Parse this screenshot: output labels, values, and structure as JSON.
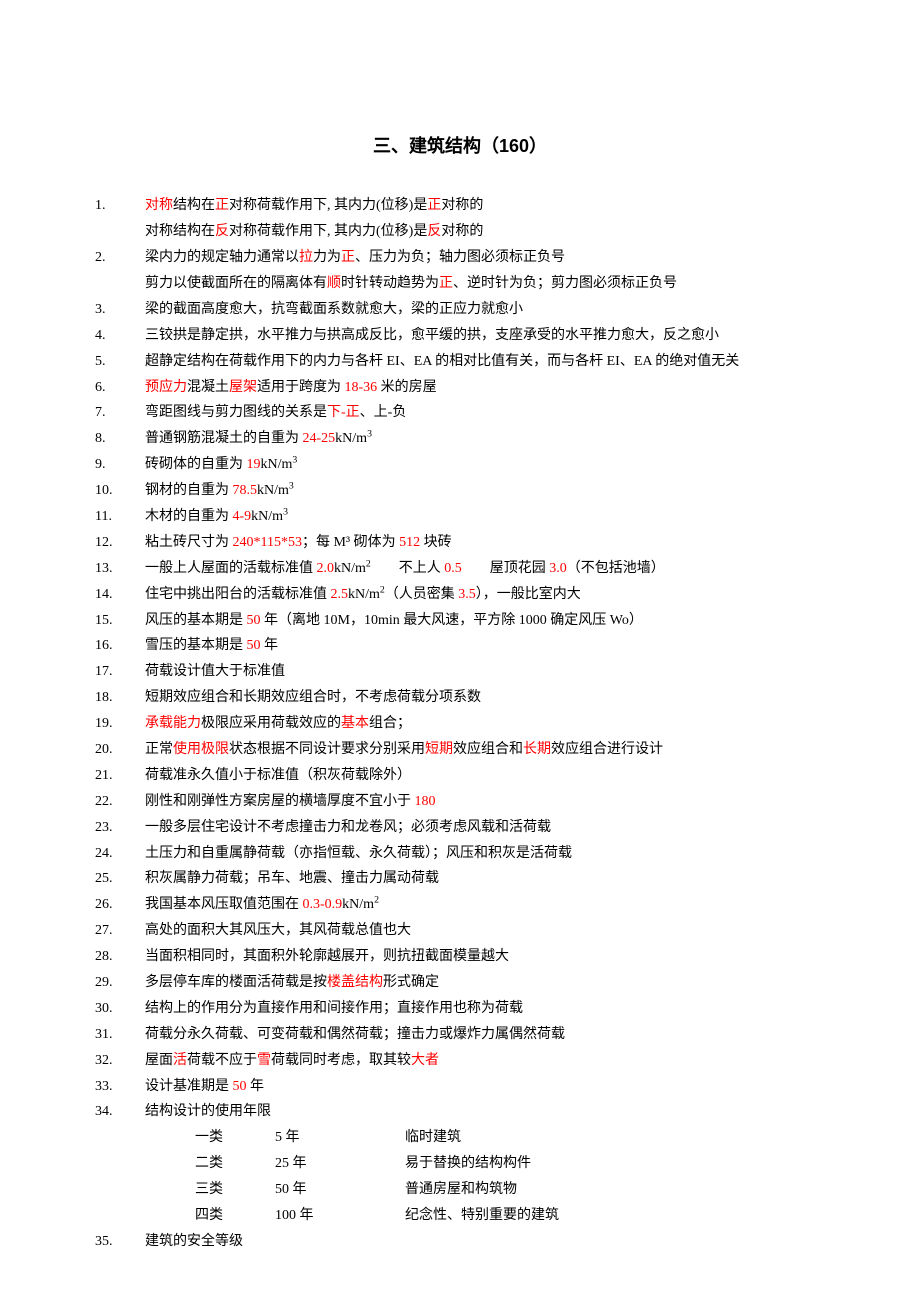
{
  "title": "三、建筑结构（160）",
  "items": [
    {
      "segs": [
        {
          "t": "对称",
          "c": "r"
        },
        {
          "t": "结构在"
        },
        {
          "t": "正",
          "c": "r"
        },
        {
          "t": "对称荷载作用下, 其内力(位移)是"
        },
        {
          "t": "正",
          "c": "r"
        },
        {
          "t": "对称的"
        }
      ],
      "sub": [
        {
          "t": "对称结构在"
        },
        {
          "t": "反",
          "c": "r"
        },
        {
          "t": "对称荷载作用下, 其内力(位移)是"
        },
        {
          "t": "反",
          "c": "r"
        },
        {
          "t": "对称的"
        }
      ]
    },
    {
      "segs": [
        {
          "t": "梁内力的规定轴力通常以"
        },
        {
          "t": "拉",
          "c": "r"
        },
        {
          "t": "力为"
        },
        {
          "t": "正",
          "c": "r"
        },
        {
          "t": "、压力为负；轴力图必须标正负号"
        }
      ],
      "sub": [
        {
          "t": "剪力以使截面所在的隔离体有"
        },
        {
          "t": "顺",
          "c": "r"
        },
        {
          "t": "时针转动趋势为"
        },
        {
          "t": "正",
          "c": "r"
        },
        {
          "t": "、逆时针为负；剪力图必须标正负号"
        }
      ]
    },
    {
      "segs": [
        {
          "t": "梁的截面高度愈大，抗弯截面系数就愈大，梁的正应力就愈小"
        }
      ]
    },
    {
      "segs": [
        {
          "t": "三铰拱是静定拱，水平推力与拱高成反比，愈平缓的拱，支座承受的水平推力愈大，反之愈小"
        }
      ]
    },
    {
      "segs": [
        {
          "t": "超静定结构在荷载作用下的内力与各杆 EI、EA 的相对比值有关，而与各杆 EI、EA 的绝对值无关"
        }
      ]
    },
    {
      "segs": [
        {
          "t": "预应力",
          "c": "r"
        },
        {
          "t": "混凝土"
        },
        {
          "t": "屋架",
          "c": "r"
        },
        {
          "t": "适用于跨度为 "
        },
        {
          "t": "18-36",
          "c": "r"
        },
        {
          "t": " 米的房屋"
        }
      ]
    },
    {
      "segs": [
        {
          "t": "弯距图线与剪力图线的关系是"
        },
        {
          "t": "下-正",
          "c": "r"
        },
        {
          "t": "、上-负"
        }
      ]
    },
    {
      "segs": [
        {
          "t": "普通钢筋混凝土的自重为 "
        },
        {
          "t": "24-25",
          "c": "r"
        },
        {
          "t": "kN/m",
          "sup": "3"
        }
      ]
    },
    {
      "segs": [
        {
          "t": "砖砌体的自重为 "
        },
        {
          "t": "19",
          "c": "r"
        },
        {
          "t": "kN/m",
          "sup": "3"
        }
      ]
    },
    {
      "segs": [
        {
          "t": "钢材的自重为 "
        },
        {
          "t": "78.5",
          "c": "r"
        },
        {
          "t": "kN/m",
          "sup": "3"
        }
      ]
    },
    {
      "segs": [
        {
          "t": "木材的自重为 "
        },
        {
          "t": "4-9",
          "c": "r"
        },
        {
          "t": "kN/m",
          "sup": "3"
        }
      ]
    },
    {
      "segs": [
        {
          "t": "粘土砖尺寸为 "
        },
        {
          "t": "240*115*53",
          "c": "r"
        },
        {
          "t": "；每 M³ 砌体为 "
        },
        {
          "t": "512",
          "c": "r"
        },
        {
          "t": " 块砖"
        }
      ]
    },
    {
      "segs": [
        {
          "t": "一般上人屋面的活载标准值 "
        },
        {
          "t": "2.0",
          "c": "r"
        },
        {
          "t": "kN/m",
          "sup": "2"
        },
        {
          "t": "　　不上人 "
        },
        {
          "t": "0.5",
          "c": "r"
        },
        {
          "t": "　　屋顶花园 "
        },
        {
          "t": "3.0",
          "c": "r"
        },
        {
          "t": "（不包括池墙）"
        }
      ]
    },
    {
      "segs": [
        {
          "t": "住宅中挑出阳台的活载标准值 "
        },
        {
          "t": "2.5",
          "c": "r"
        },
        {
          "t": "kN/m",
          "sup": "2"
        },
        {
          "t": "（人员密集 "
        },
        {
          "t": "3.5",
          "c": "r"
        },
        {
          "t": "），一般比室内大"
        }
      ]
    },
    {
      "segs": [
        {
          "t": "风压的基本期是 "
        },
        {
          "t": "50",
          "c": "r"
        },
        {
          "t": " 年（离地 10M，10min 最大风速，平方除 1000 确定风压 Wo）"
        }
      ]
    },
    {
      "segs": [
        {
          "t": "雪压的基本期是 "
        },
        {
          "t": "50",
          "c": "r"
        },
        {
          "t": " 年"
        }
      ]
    },
    {
      "segs": [
        {
          "t": "荷载设计值大于标准值"
        }
      ]
    },
    {
      "segs": [
        {
          "t": "短期效应组合和长期效应组合时，不考虑荷载分项系数"
        }
      ]
    },
    {
      "segs": [
        {
          "t": "承载能力",
          "c": "r"
        },
        {
          "t": "极限应采用荷载效应的"
        },
        {
          "t": "基本",
          "c": "r"
        },
        {
          "t": "组合；"
        }
      ]
    },
    {
      "segs": [
        {
          "t": "正常"
        },
        {
          "t": "使用极限",
          "c": "r"
        },
        {
          "t": "状态根据不同设计要求分别采用"
        },
        {
          "t": "短期",
          "c": "r"
        },
        {
          "t": "效应组合和"
        },
        {
          "t": "长期",
          "c": "r"
        },
        {
          "t": "效应组合进行设计"
        }
      ]
    },
    {
      "segs": [
        {
          "t": "荷载准永久值小于标准值（积灰荷载除外）"
        }
      ]
    },
    {
      "segs": [
        {
          "t": "刚性和刚弹性方案房屋的横墙厚度不宜小于 "
        },
        {
          "t": "180",
          "c": "r"
        }
      ]
    },
    {
      "segs": [
        {
          "t": "一般多层住宅设计不考虑撞击力和龙卷风；必须考虑风载和活荷载"
        }
      ]
    },
    {
      "segs": [
        {
          "t": "土压力和自重属静荷载（亦指恒载、永久荷载）；风压和积灰是活荷载"
        }
      ]
    },
    {
      "segs": [
        {
          "t": "积灰属静力荷载；吊车、地震、撞击力属动荷载"
        }
      ]
    },
    {
      "segs": [
        {
          "t": "我国基本风压取值范围在 "
        },
        {
          "t": "0.3-0.9",
          "c": "r"
        },
        {
          "t": "kN/m",
          "sup": "2"
        }
      ]
    },
    {
      "segs": [
        {
          "t": "高处的面积大其风压大，其风荷载总值也大"
        }
      ]
    },
    {
      "segs": [
        {
          "t": "当面积相同时，其面积外轮廓越展开，则抗扭截面模量越大"
        }
      ]
    },
    {
      "segs": [
        {
          "t": "多层停车库的楼面活荷载是按"
        },
        {
          "t": "楼盖结构",
          "c": "r"
        },
        {
          "t": "形式确定"
        }
      ]
    },
    {
      "segs": [
        {
          "t": "结构上的作用分为直接作用和间接作用；直接作用也称为荷载"
        }
      ]
    },
    {
      "segs": [
        {
          "t": "荷载分永久荷载、可变荷载和偶然荷载；撞击力或爆炸力属偶然荷载"
        }
      ]
    },
    {
      "segs": [
        {
          "t": "屋面"
        },
        {
          "t": "活",
          "c": "r"
        },
        {
          "t": "荷载不应于"
        },
        {
          "t": "雪",
          "c": "r"
        },
        {
          "t": "荷载同时考虑，取其较"
        },
        {
          "t": "大者",
          "c": "r"
        }
      ]
    },
    {
      "segs": [
        {
          "t": "设计基准期是 "
        },
        {
          "t": "50",
          "c": "r"
        },
        {
          "t": " 年"
        }
      ]
    },
    {
      "segs": [
        {
          "t": "结构设计的使用年限"
        }
      ],
      "table": [
        [
          "一类",
          "5  年",
          "临时建筑"
        ],
        [
          "二类",
          "25 年",
          "易于替换的结构构件"
        ],
        [
          "三类",
          "50 年",
          "普通房屋和构筑物"
        ],
        [
          "四类",
          "100 年",
          "纪念性、特别重要的建筑"
        ]
      ]
    },
    {
      "segs": [
        {
          "t": "建筑的安全等级"
        }
      ]
    }
  ]
}
